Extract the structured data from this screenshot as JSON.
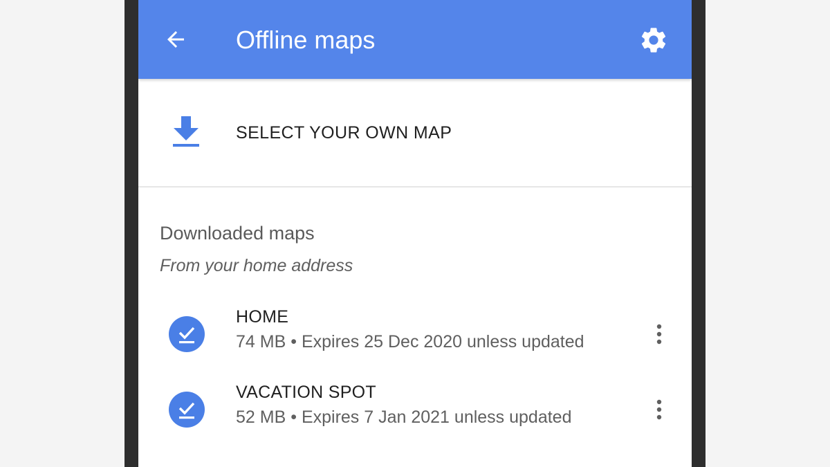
{
  "appbar": {
    "title": "Offline maps",
    "back_icon": "arrow-back-icon",
    "settings_icon": "gear-icon",
    "color": "#5485ea"
  },
  "select_map": {
    "label": "SELECT YOUR OWN MAP",
    "icon": "download-icon",
    "icon_color": "#4a7fe6"
  },
  "downloaded": {
    "title": "Downloaded maps",
    "subtitle": "From your home address",
    "items": [
      {
        "name": "HOME",
        "size": "74 MB",
        "separator": "•",
        "expiry": "Expires 25 Dec 2020 unless updated",
        "icon": "check-circle-icon",
        "menu_icon": "more-vert-icon"
      },
      {
        "name": "VACATION SPOT",
        "size": "52 MB",
        "separator": "•",
        "expiry": "Expires 7 Jan 2021 unless updated",
        "icon": "check-circle-icon",
        "menu_icon": "more-vert-icon"
      }
    ]
  }
}
